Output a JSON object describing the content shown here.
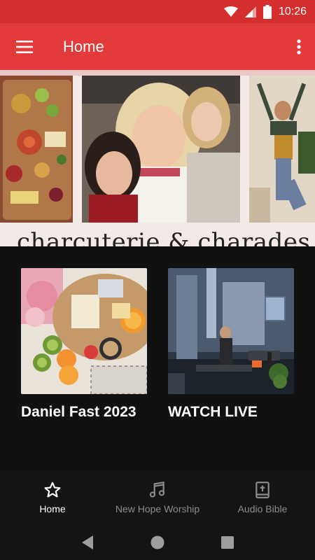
{
  "status_bar": {
    "time": "10:26",
    "icons": [
      "wifi-icon",
      "signal-icon",
      "battery-icon"
    ]
  },
  "app_bar": {
    "title": "Home",
    "menu_icon": "hamburger-menu-icon",
    "overflow_icon": "more-vert-icon",
    "color": "#e33b3b"
  },
  "hero": {
    "caption": "charcuterie & charades"
  },
  "cards": [
    {
      "title": "Daniel Fast 2023"
    },
    {
      "title": "WATCH LIVE"
    }
  ],
  "bottom_nav": {
    "items": [
      {
        "label": "Home",
        "icon": "star-icon",
        "active": true
      },
      {
        "label": "New Hope Worship",
        "icon": "music-note-icon",
        "active": false
      },
      {
        "label": "Audio Bible",
        "icon": "bible-icon",
        "active": false
      }
    ]
  },
  "system_nav": {
    "buttons": [
      "back-icon",
      "home-circle-icon",
      "recents-icon"
    ]
  }
}
